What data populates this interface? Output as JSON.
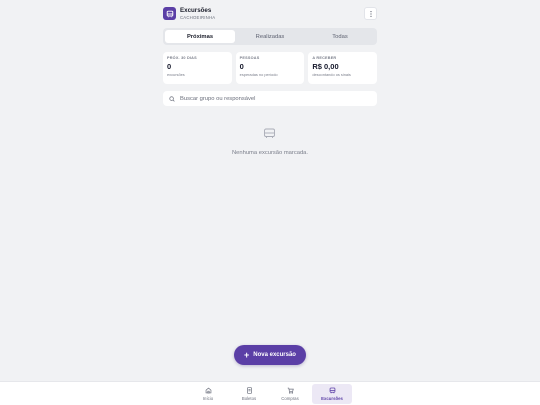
{
  "header": {
    "title": "Excursões",
    "subtitle": "CACHOEIRINHA",
    "icon": "bus-icon",
    "menu_icon": "more-vertical-icon"
  },
  "tabs": [
    {
      "label": "Próximas",
      "active": true
    },
    {
      "label": "Realizadas",
      "active": false
    },
    {
      "label": "Todas",
      "active": false
    }
  ],
  "stats": [
    {
      "label": "PRÓX. 30 DIAS",
      "value": "0",
      "note": "excursões"
    },
    {
      "label": "PESSOAS",
      "value": "0",
      "note": "esperadas no período"
    },
    {
      "label": "A RECEBER",
      "value": "R$ 0,00",
      "note": "descontando os sinais"
    }
  ],
  "search": {
    "placeholder": "Buscar grupo ou responsável",
    "value": ""
  },
  "empty_state": {
    "icon": "bus-icon",
    "text": "Nenhuma excursão marcada."
  },
  "fab": {
    "label": "Nova excursão",
    "icon": "plus-icon"
  },
  "bottom_nav": [
    {
      "label": "Início",
      "icon": "home-icon",
      "active": false
    },
    {
      "label": "Boletos",
      "icon": "receipt-icon",
      "active": false
    },
    {
      "label": "Compras",
      "icon": "cart-icon",
      "active": false
    },
    {
      "label": "Excursões",
      "icon": "bus-icon",
      "active": true
    }
  ],
  "colors": {
    "accent": "#5b3fa6",
    "background": "#f1f2f4",
    "surface": "#ffffff"
  }
}
